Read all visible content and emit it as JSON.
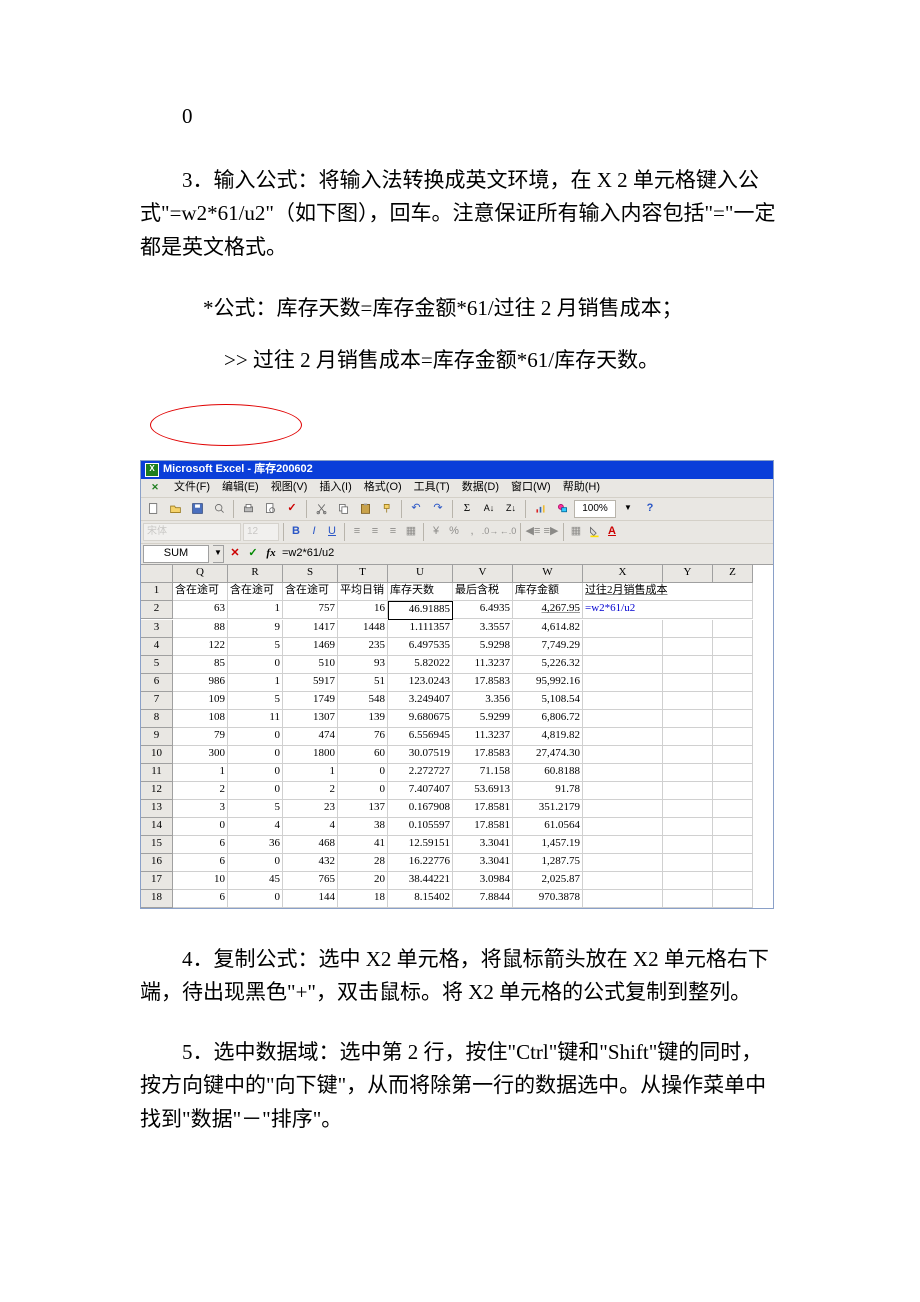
{
  "doc": {
    "line0": "0",
    "para3": "3．输入公式：将输入法转换成英文环境，在 X 2 单元格键入公式\"=w2*61/u2\"（如下图），回车。注意保证所有输入内容包括\"=\"一定都是英文格式。",
    "formula_line": "*公式：库存天数=库存金额*61/过往 2 月销售成本；",
    "derive_line": ">> 过往 2 月销售成本=库存金额*61/库存天数。",
    "para4": "4．复制公式：选中 X2 单元格，将鼠标箭头放在 X2 单元格右下端，待出现黑色\"+\"，双击鼠标。将 X2 单元格的公式复制到整列。",
    "para5": "5．选中数据域：选中第 2 行，按住\"Ctrl\"键和\"Shift\"键的同时，按方向键中的\"向下键\"，从而将除第一行的数据选中。从操作菜单中找到\"数据\"－\"排序\"。"
  },
  "excel": {
    "title": "Microsoft Excel - 库存200602",
    "menus": [
      "文件(F)",
      "编辑(E)",
      "视图(V)",
      "插入(I)",
      "格式(O)",
      "工具(T)",
      "数据(D)",
      "窗口(W)",
      "帮助(H)"
    ],
    "zoom": "100%",
    "font_name": "宋体",
    "font_size": "12",
    "name_box": "SUM",
    "formula": "=w2*61/u2",
    "columns": [
      "Q",
      "R",
      "S",
      "T",
      "U",
      "V",
      "W",
      "X",
      "Y",
      "Z"
    ],
    "header_row": {
      "Q": "含在途可",
      "R": "含在途可",
      "S": "含在途可",
      "T": "平均日销",
      "U": "库存天数",
      "V": "最后含税",
      "W": "库存金额",
      "X": "过往2月销售成本"
    },
    "chart_data": {
      "type": "table",
      "columns": [
        "row",
        "Q",
        "R",
        "S",
        "T",
        "U",
        "V",
        "W",
        "X"
      ],
      "rows": [
        {
          "row": 2,
          "Q": 63,
          "R": 1,
          "S": 757,
          "T": 16,
          "U": 46.91885,
          "V": 6.4935,
          "W": "4,267.95",
          "X": "=w2*61/u2"
        },
        {
          "row": 3,
          "Q": 88,
          "R": 9,
          "S": 1417,
          "T": 1448,
          "U": 1.111357,
          "V": 3.3557,
          "W": "4,614.82",
          "X": ""
        },
        {
          "row": 4,
          "Q": 122,
          "R": 5,
          "S": 1469,
          "T": 235,
          "U": 6.497535,
          "V": 5.9298,
          "W": "7,749.29",
          "X": ""
        },
        {
          "row": 5,
          "Q": 85,
          "R": 0,
          "S": 510,
          "T": 93,
          "U": 5.82022,
          "V": 11.3237,
          "W": "5,226.32",
          "X": ""
        },
        {
          "row": 6,
          "Q": 986,
          "R": 1,
          "S": 5917,
          "T": 51,
          "U": 123.0243,
          "V": 17.8583,
          "W": "95,992.16",
          "X": ""
        },
        {
          "row": 7,
          "Q": 109,
          "R": 5,
          "S": 1749,
          "T": 548,
          "U": 3.249407,
          "V": 3.356,
          "W": "5,108.54",
          "X": ""
        },
        {
          "row": 8,
          "Q": 108,
          "R": 11,
          "S": 1307,
          "T": 139,
          "U": 9.680675,
          "V": 5.9299,
          "W": "6,806.72",
          "X": ""
        },
        {
          "row": 9,
          "Q": 79,
          "R": 0,
          "S": 474,
          "T": 76,
          "U": 6.556945,
          "V": 11.3237,
          "W": "4,819.82",
          "X": ""
        },
        {
          "row": 10,
          "Q": 300,
          "R": 0,
          "S": 1800,
          "T": 60,
          "U": 30.07519,
          "V": 17.8583,
          "W": "27,474.30",
          "X": ""
        },
        {
          "row": 11,
          "Q": 1,
          "R": 0,
          "S": 1,
          "T": 0,
          "U": 2.272727,
          "V": 71.158,
          "W": "60.8188",
          "X": ""
        },
        {
          "row": 12,
          "Q": 2,
          "R": 0,
          "S": 2,
          "T": 0,
          "U": 7.407407,
          "V": 53.6913,
          "W": "91.78",
          "X": ""
        },
        {
          "row": 13,
          "Q": 3,
          "R": 5,
          "S": 23,
          "T": 137,
          "U": 0.167908,
          "V": 17.8581,
          "W": "351.2179",
          "X": ""
        },
        {
          "row": 14,
          "Q": 0,
          "R": 4,
          "S": 4,
          "T": 38,
          "U": 0.105597,
          "V": 17.8581,
          "W": "61.0564",
          "X": ""
        },
        {
          "row": 15,
          "Q": 6,
          "R": 36,
          "S": 468,
          "T": 41,
          "U": 12.59151,
          "V": 3.3041,
          "W": "1,457.19",
          "X": ""
        },
        {
          "row": 16,
          "Q": 6,
          "R": 0,
          "S": 432,
          "T": 28,
          "U": 16.22776,
          "V": 3.3041,
          "W": "1,287.75",
          "X": ""
        },
        {
          "row": 17,
          "Q": 10,
          "R": 45,
          "S": 765,
          "T": 20,
          "U": 38.44221,
          "V": 3.0984,
          "W": "2,025.87",
          "X": ""
        },
        {
          "row": 18,
          "Q": 6,
          "R": 0,
          "S": 144,
          "T": 18,
          "U": 8.15402,
          "V": 7.8844,
          "W": "970.3878",
          "X": ""
        }
      ]
    }
  }
}
